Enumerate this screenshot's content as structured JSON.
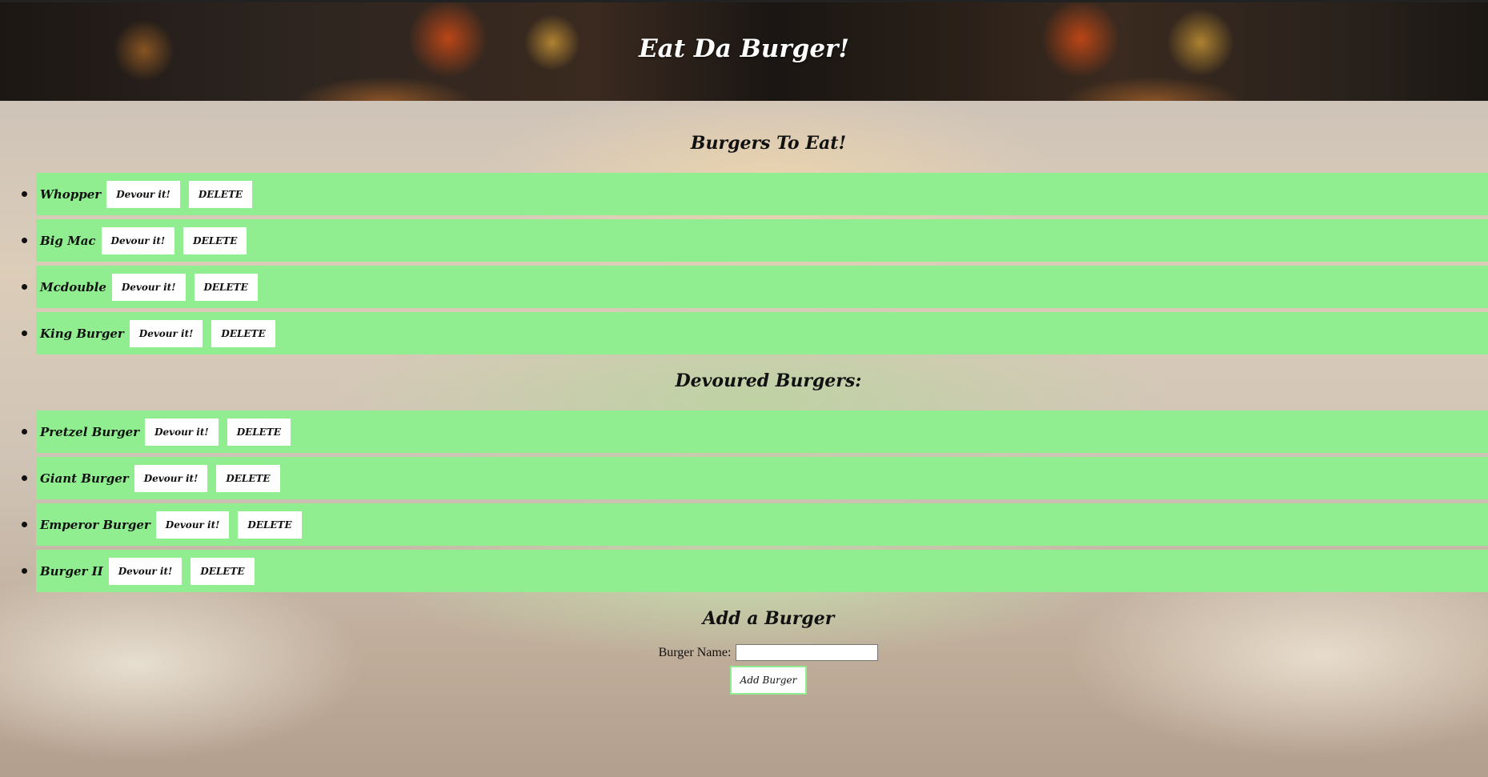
{
  "header": {
    "title": "Eat Da Burger!"
  },
  "to_eat": {
    "title": "Burgers To Eat!",
    "items": [
      {
        "name": "Whopper",
        "devour_label": "Devour it!",
        "delete_label": "DELETE"
      },
      {
        "name": "Big Mac",
        "devour_label": "Devour it!",
        "delete_label": "DELETE"
      },
      {
        "name": "Mcdouble",
        "devour_label": "Devour it!",
        "delete_label": "DELETE"
      },
      {
        "name": "King Burger",
        "devour_label": "Devour it!",
        "delete_label": "DELETE"
      }
    ]
  },
  "devoured": {
    "title": "Devoured Burgers:",
    "items": [
      {
        "name": "Pretzel Burger",
        "devour_label": "Devour it!",
        "delete_label": "DELETE"
      },
      {
        "name": "Giant Burger",
        "devour_label": "Devour it!",
        "delete_label": "DELETE"
      },
      {
        "name": "Emperor Burger",
        "devour_label": "Devour it!",
        "delete_label": "DELETE"
      },
      {
        "name": "Burger II",
        "devour_label": "Devour it!",
        "delete_label": "DELETE"
      }
    ]
  },
  "add_form": {
    "title": "Add a Burger",
    "name_label": "Burger Name:",
    "name_value": "",
    "submit_label": "Add Burger"
  },
  "colors": {
    "row_background": "#90ee90",
    "button_background": "#ffffff",
    "header_text": "#ffffff"
  }
}
